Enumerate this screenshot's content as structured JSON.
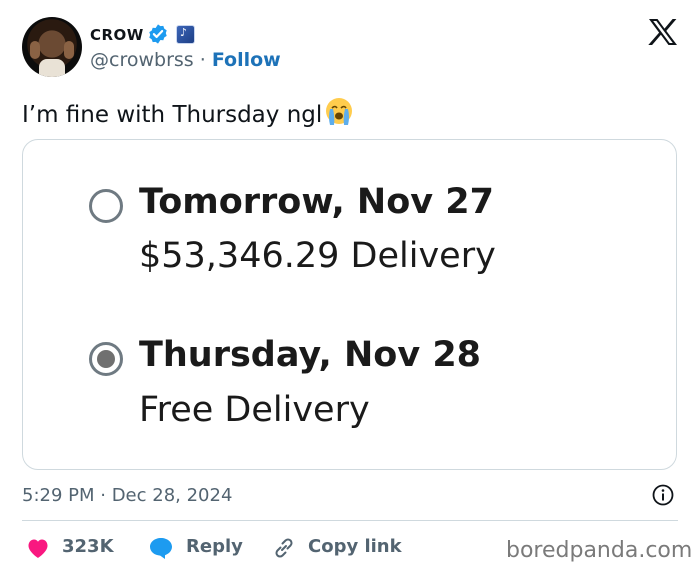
{
  "author": {
    "display_name": "CROW",
    "handle": "@crowbrss",
    "separator": "·",
    "follow_label": "Follow"
  },
  "tweet": {
    "text": "I’m fine with Thursday ngl",
    "emoji": "loudly-crying-face"
  },
  "delivery_options": [
    {
      "title": "Tomorrow, Nov 27",
      "subtitle": "$53,346.29 Delivery",
      "selected": false
    },
    {
      "title": "Thursday, Nov 28",
      "subtitle": "Free Delivery",
      "selected": true
    }
  ],
  "meta": {
    "timestamp": "5:29 PM · Dec 28, 2024"
  },
  "actions": {
    "likes": "323K",
    "reply_label": "Reply",
    "copy_link_label": "Copy link"
  },
  "watermark": "boredpanda.com",
  "colors": {
    "follow": "#1d72b8",
    "verified": "#1d9bf0",
    "heart": "#f91880",
    "reply": "#1d9bf0",
    "muted": "#536471"
  }
}
